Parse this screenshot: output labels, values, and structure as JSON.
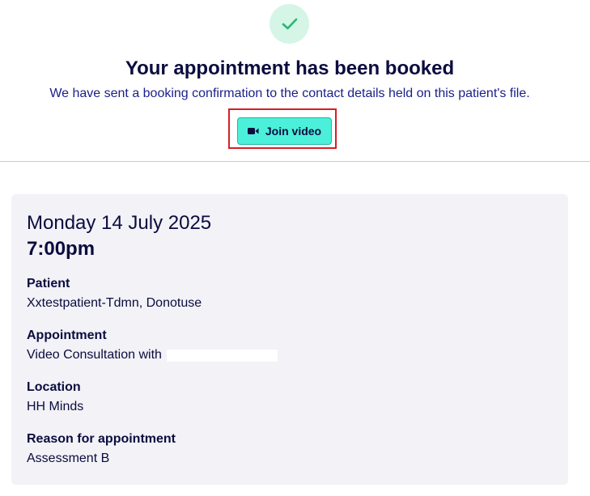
{
  "confirmation": {
    "icon": "check-icon",
    "title": "Your appointment has been booked",
    "message": "We have sent a booking confirmation to the contact details held on this patient's file."
  },
  "join_button": {
    "label": "Join video",
    "icon": "video-camera-icon"
  },
  "appointment": {
    "date": "Monday 14 July 2025",
    "time": "7:00pm",
    "patient_label": "Patient",
    "patient_value": "Xxtestpatient-Tdmn, Donotuse",
    "appointment_label": "Appointment",
    "appointment_value": "Video Consultation with",
    "location_label": "Location",
    "location_value": "HH Minds",
    "reason_label": "Reason for appointment",
    "reason_value": "Assessment B"
  },
  "colors": {
    "success_bg": "#d5f5e6",
    "success_check": "#2bb673",
    "button_bg": "#4cefd9",
    "highlight": "#d32027",
    "card_bg": "#f2f2f7",
    "text": "#0b0c3e"
  }
}
